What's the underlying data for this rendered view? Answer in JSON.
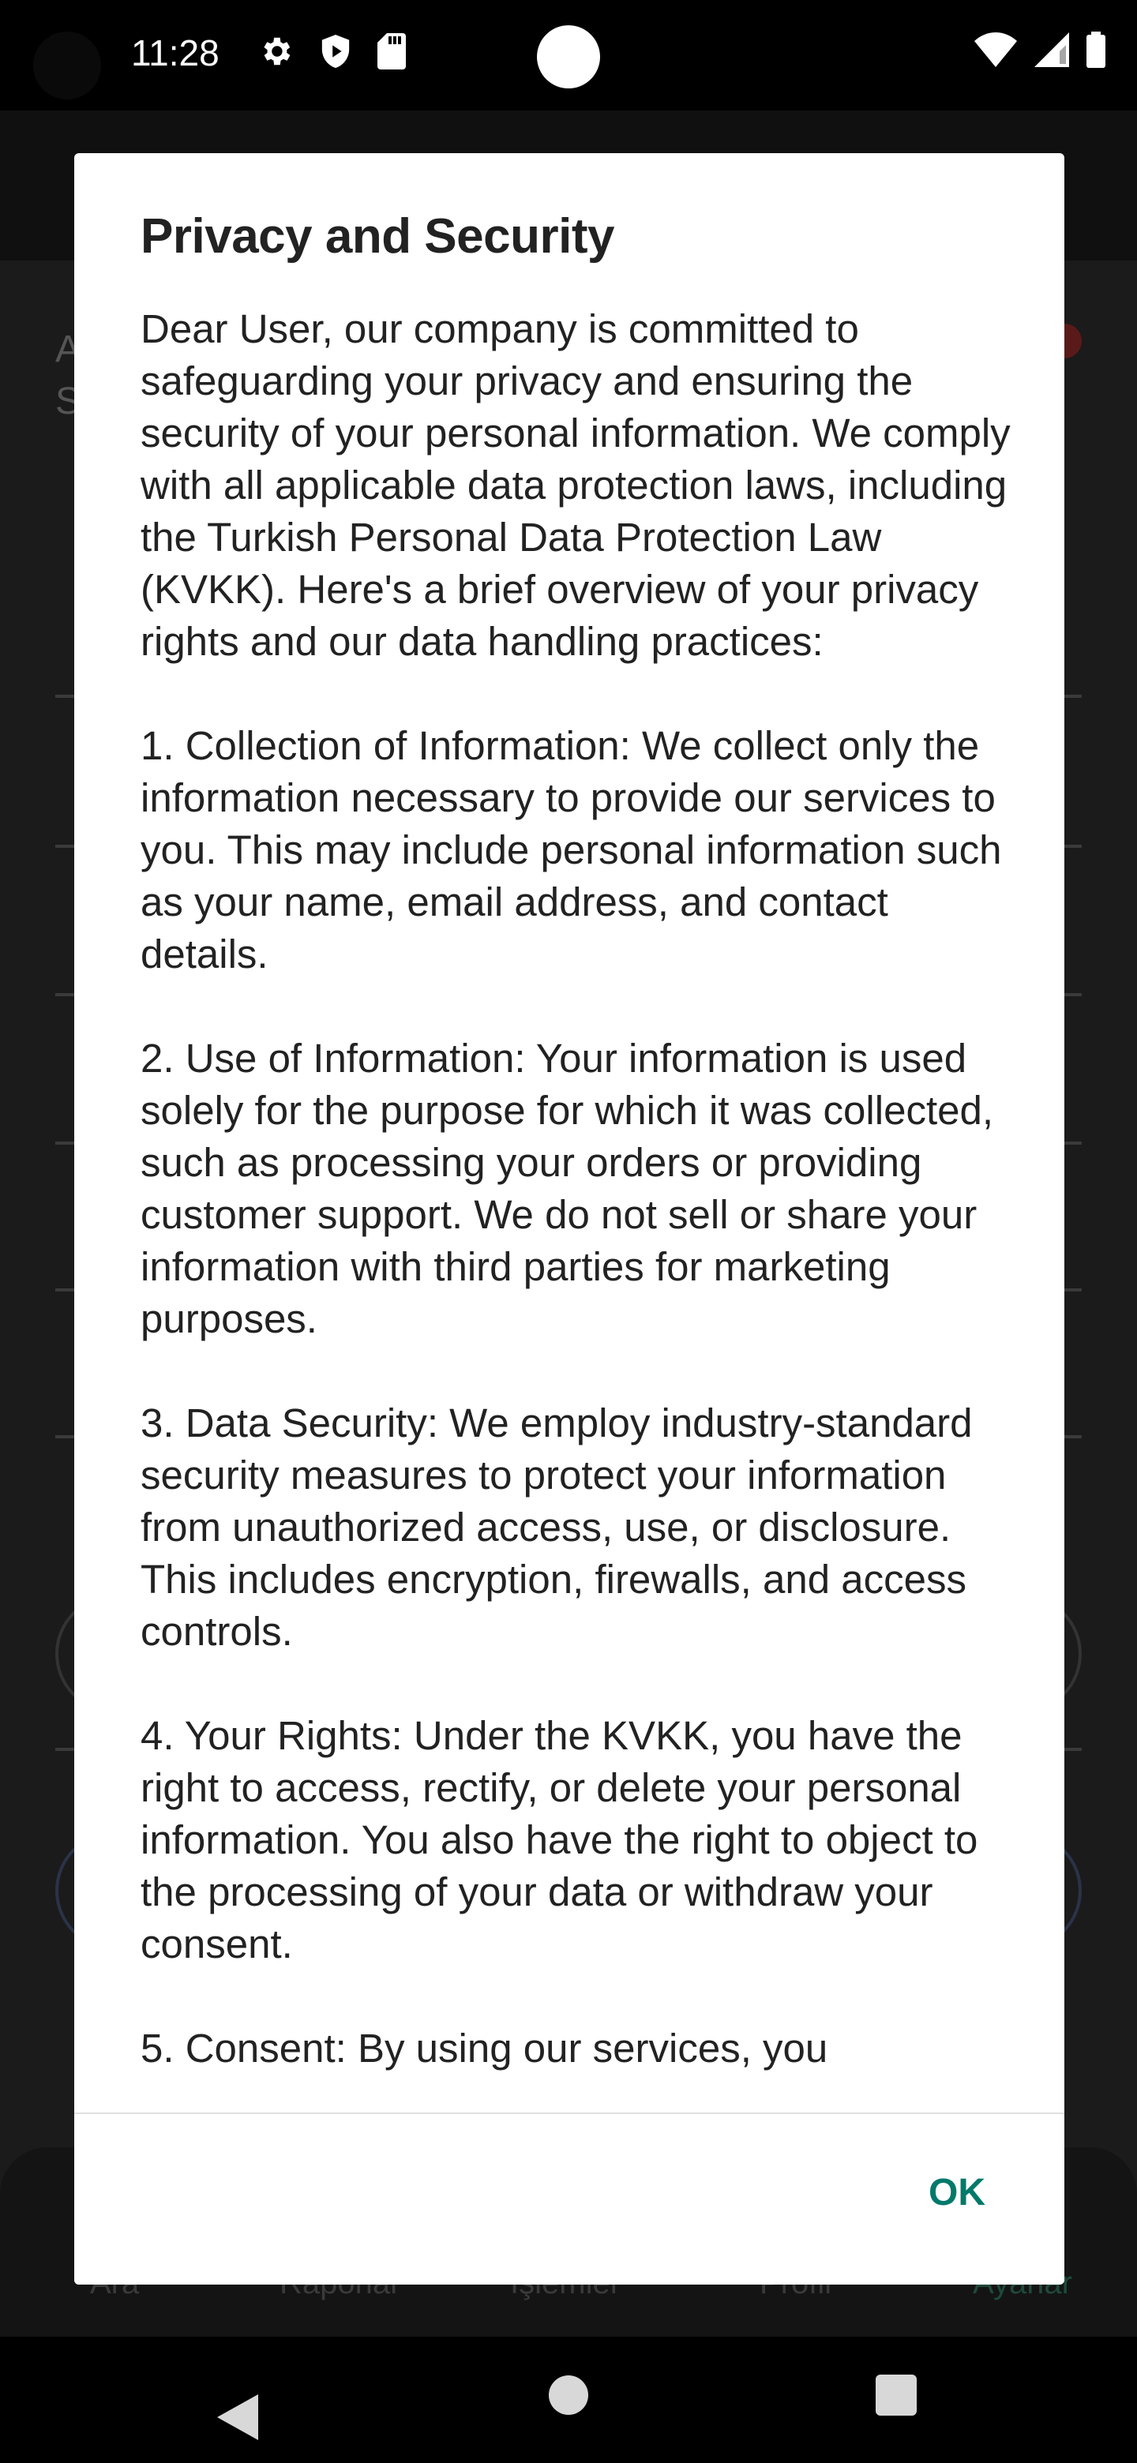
{
  "status_bar": {
    "time": "11:28",
    "left_icons": [
      "gear-icon",
      "shield-icon",
      "sd-card-icon"
    ],
    "right_icons": [
      "wifi-icon",
      "signal-icon",
      "battery-icon"
    ]
  },
  "background_app": {
    "bottom_nav": [
      {
        "label": "Ara"
      },
      {
        "label": "Raporlar"
      },
      {
        "label": "İşlemler"
      },
      {
        "label": "Profil"
      },
      {
        "label": "Ayarlar",
        "active": true
      }
    ]
  },
  "dialog": {
    "title": "Privacy and Security",
    "body": "Dear User, our company is committed to safeguarding your privacy and ensuring the security of your personal information. We comply with all applicable data protection laws, including the Turkish Personal Data Protection Law (KVKK). Here's a brief overview of your privacy rights and our data handling practices:\n\n1. Collection of Information: We collect only the information necessary to provide our services to you. This may include personal information such as your name, email address, and contact details.\n\n2. Use of Information: Your information is used solely for the purpose for which it was collected, such as processing your orders or providing customer support. We do not sell or share your information with third parties for marketing purposes.\n\n3. Data Security: We employ industry-standard security measures to protect your information from unauthorized access, use, or disclosure. This includes encryption, firewalls, and access controls.\n\n4. Your Rights: Under the KVKK, you have the right to access, rectify, or delete your personal information. You also have the right to object to the processing of your data or withdraw your consent.\n\n5. Consent: By using our services, you",
    "ok_label": "OK",
    "accent_color": "#00796b"
  },
  "nav_bar": {
    "icons": [
      "back-icon",
      "home-icon",
      "recents-icon"
    ]
  }
}
